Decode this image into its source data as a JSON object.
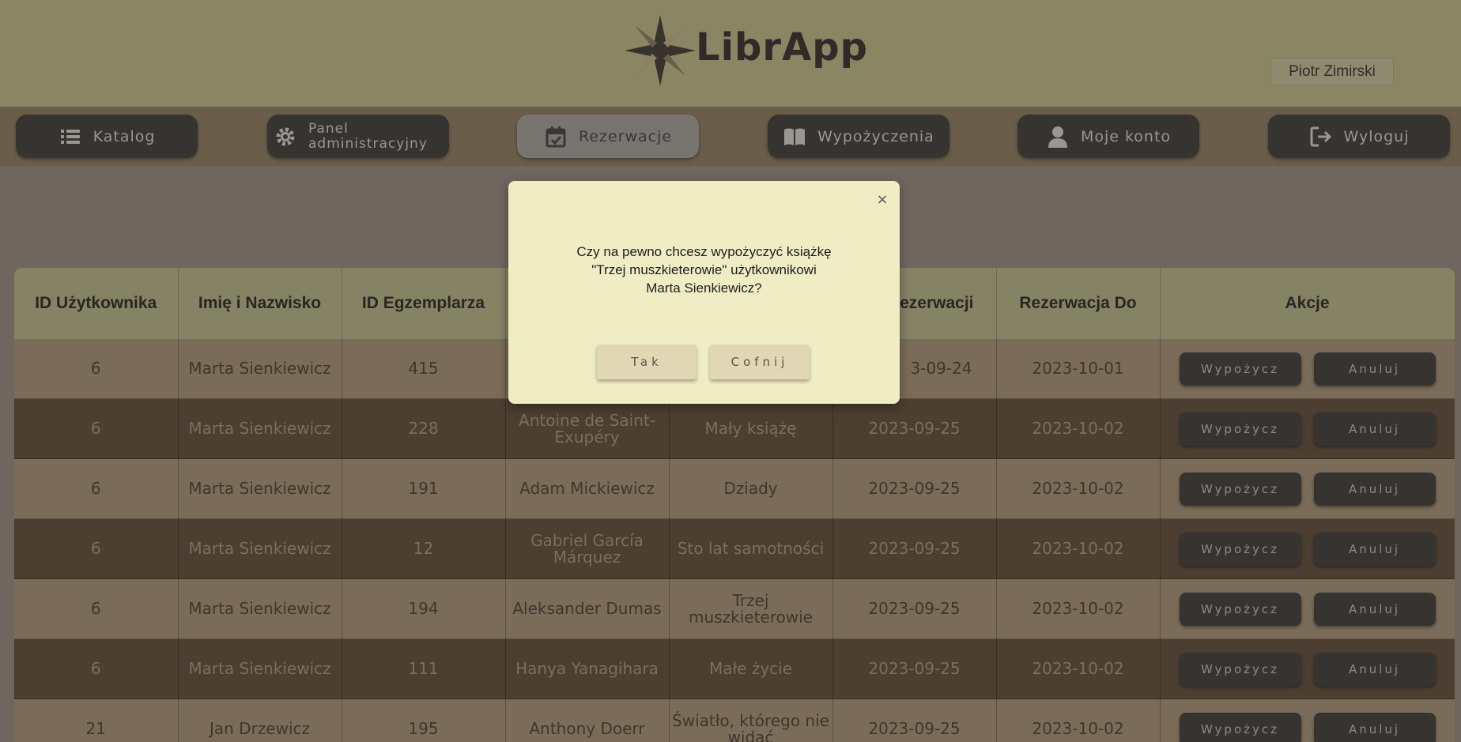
{
  "app": {
    "title": "LibrApp"
  },
  "user": {
    "name": "Piotr Zimirski"
  },
  "nav": [
    {
      "label": "Katalog",
      "icon": "list-icon"
    },
    {
      "label": "Panel administracyjny",
      "icon": "gear-icon"
    },
    {
      "label": "Rezerwacje",
      "icon": "calendar-check-icon",
      "active": true
    },
    {
      "label": "Wypożyczenia",
      "icon": "book-open-icon"
    },
    {
      "label": "Moje konto",
      "icon": "user-icon"
    },
    {
      "label": "Wyloguj",
      "icon": "logout-icon"
    }
  ],
  "table": {
    "headers": [
      "ID Użytkownika",
      "Imię i Nazwisko",
      "ID Egzemplarza",
      "",
      "",
      "Rezerwacji",
      "Rezerwacja Do",
      "Akcje"
    ],
    "rows": [
      [
        "6",
        "Marta Sienkiewicz",
        "415",
        "",
        "",
        "3-09-24",
        "2023-10-01"
      ],
      [
        "6",
        "Marta Sienkiewicz",
        "228",
        "Antoine de Saint-Exupéry",
        "Mały książę",
        "2023-09-25",
        "2023-10-02"
      ],
      [
        "6",
        "Marta Sienkiewicz",
        "191",
        "Adam Mickiewicz",
        "Dziady",
        "2023-09-25",
        "2023-10-02"
      ],
      [
        "6",
        "Marta Sienkiewicz",
        "12",
        "Gabriel García Márquez",
        "Sto lat samotności",
        "2023-09-25",
        "2023-10-02"
      ],
      [
        "6",
        "Marta Sienkiewicz",
        "194",
        "Aleksander Dumas",
        "Trzej muszkieterowie",
        "2023-09-25",
        "2023-10-02"
      ],
      [
        "6",
        "Marta Sienkiewicz",
        "111",
        "Hanya Yanagihara",
        "Małe życie",
        "2023-09-25",
        "2023-10-02"
      ],
      [
        "21",
        "Jan Drzewicz",
        "195",
        "Anthony Doerr",
        "Światło, którego nie widać",
        "2023-09-25",
        "2023-10-02"
      ]
    ],
    "action_borrow": "Wypożycz",
    "action_cancel": "Anuluj"
  },
  "modal": {
    "line1": "Czy na pewno chcesz wypożyczyć książkę",
    "line2": "\"Trzej muszkieterowie\" użytkownikowi",
    "line3": "Marta Sienkiewicz?",
    "confirm": "Tak",
    "back": "Cofnij",
    "close": "×"
  }
}
